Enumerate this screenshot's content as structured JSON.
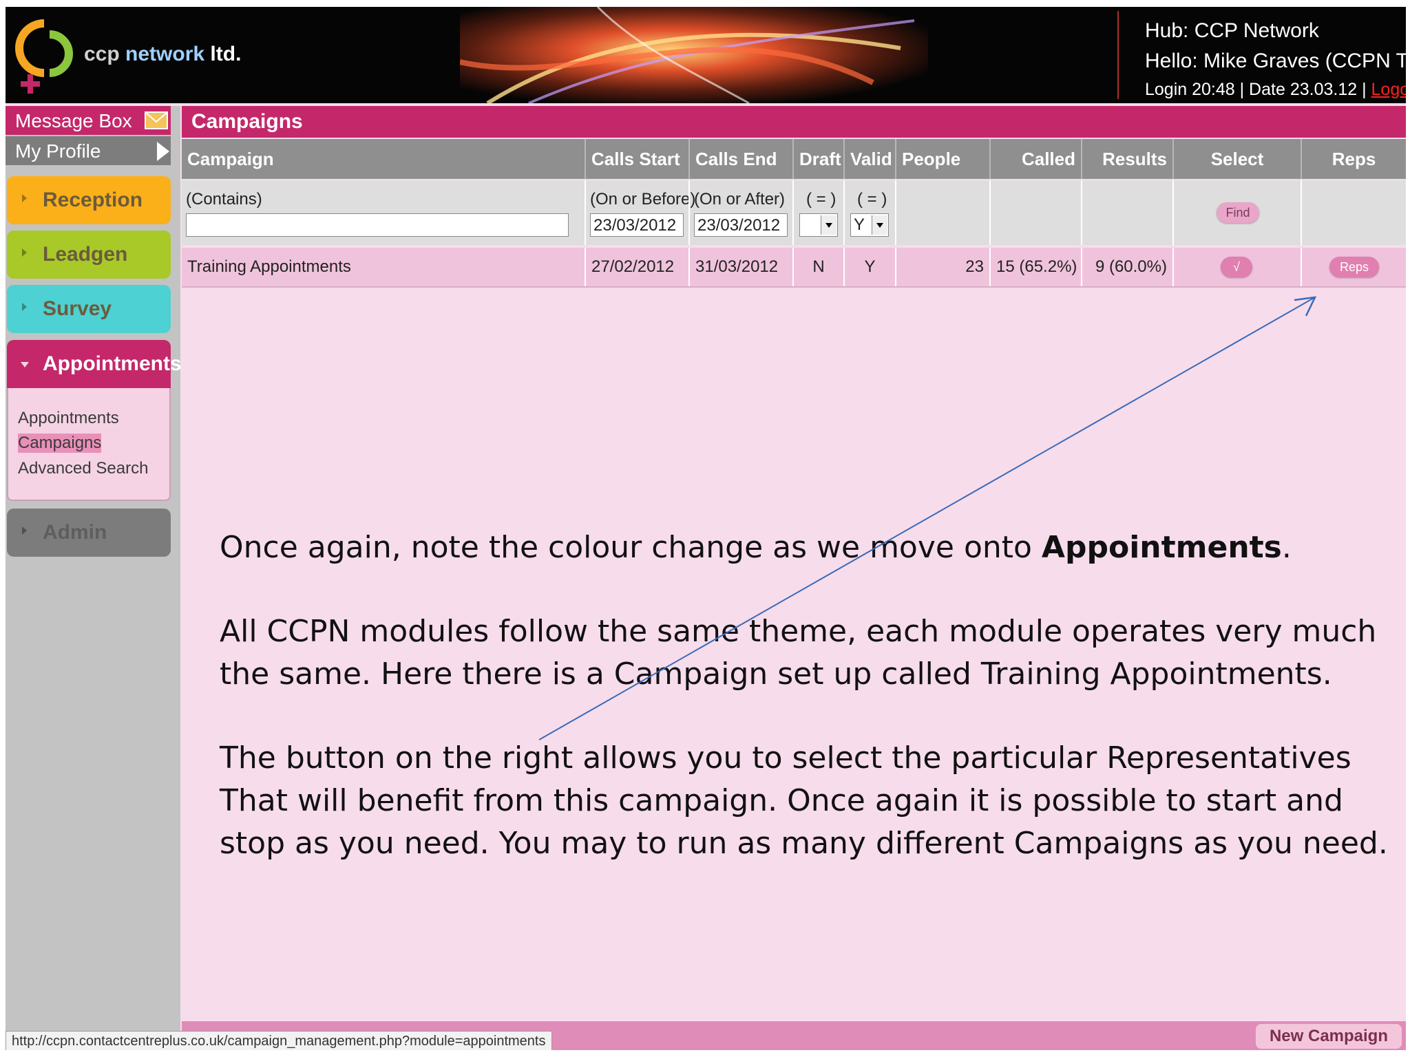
{
  "header": {
    "brand_prefix": "ccp",
    "brand_mid": "network",
    "brand_suffix": "ltd.",
    "hub": "Hub: CCP Network",
    "hello": "Hello: Mike Graves (CCPN Training)",
    "login": "Login 20:48 | Date 23.03.12 | ",
    "logout": "Logout"
  },
  "sidebar": {
    "message_box": "Message Box",
    "my_profile": "My Profile",
    "nav": [
      {
        "label": "Reception",
        "color": "#fbb01a"
      },
      {
        "label": "Leadgen",
        "color": "#a8c928"
      },
      {
        "label": "Survey",
        "color": "#4ed1d2"
      },
      {
        "label": "Appointments",
        "color": "#c4286a"
      },
      {
        "label": "Admin",
        "color": "#7c7c7c"
      }
    ],
    "subnav": [
      "Appointments",
      "Campaigns",
      "Advanced Search"
    ]
  },
  "main": {
    "title": "Campaigns",
    "columns": [
      "Campaign",
      "Calls Start",
      "Calls End",
      "Draft",
      "Valid",
      "People",
      "Called",
      "Results",
      "Select",
      "Reps"
    ],
    "filters": {
      "campaign_label": "(Contains)",
      "campaign_value": "",
      "start_label": "(On or Before)",
      "start_value": "23/03/2012",
      "end_label": "(On or After)",
      "end_value": "23/03/2012",
      "draft_label": "( = )",
      "draft_value": "",
      "valid_label": "( = )",
      "valid_value": "Y",
      "find": "Find"
    },
    "rows": [
      {
        "campaign": "Training Appointments",
        "calls_start": "27/02/2012",
        "calls_end": "31/03/2012",
        "draft": "N",
        "valid": "Y",
        "people": "23",
        "called": "15 (65.2%)",
        "results": "9 (60.0%)",
        "select": "√",
        "reps": "Reps"
      }
    ],
    "new_campaign": "New Campaign",
    "status_url": "http://ccpn.contactcentreplus.co.uk/campaign_management.php?module=appointments"
  },
  "slide": {
    "p1_before": "Once again, note the colour change as we move onto ",
    "p1_bold": "Appointments",
    "p1_after": ".",
    "p2_line1": "All CCPN modules follow the same theme, each module operates very much",
    "p2_line2": "the same.  Here there is a Campaign set up called Training Appointments.",
    "p3_line1": "The button on the right allows you to select the particular Representatives",
    "p3_line2": "That will benefit from this campaign.   Once again it is possible to start and",
    "p3_line3": "stop as you need.  You may to run as many different Campaigns as you need."
  },
  "colors": {
    "accent": "#c4286a",
    "page_bg": "#f7dcec",
    "row_bg": "#f0c3dc",
    "header_grey": "#8f8f8f",
    "arrow": "#3a6ab8"
  }
}
